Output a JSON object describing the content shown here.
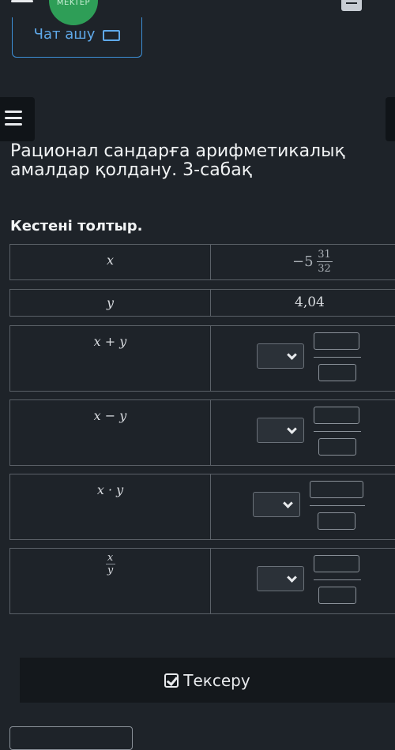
{
  "header": {
    "logo_text": "MEKTEP",
    "chat_button_label": "Чат ашу"
  },
  "lesson": {
    "title": "Рационал сандарға арифметикалық амалдар қолдану. 3-сабақ",
    "instruction": "Кестені толтыр."
  },
  "table": {
    "rows": [
      {
        "label": "x",
        "value_whole": "−5",
        "value_num": "31",
        "value_den": "32"
      },
      {
        "label": "y",
        "value": "4,04"
      },
      {
        "label": "x + y"
      },
      {
        "label": "x − y"
      },
      {
        "label": "x · y"
      },
      {
        "label_num": "x",
        "label_den": "y"
      }
    ]
  },
  "footer": {
    "check_button_label": "Тексеру"
  },
  "icons": {
    "menu": "hamburger-menu-icon",
    "chat": "chat-icon",
    "book": "book-icon",
    "chevron": "chevron-down-icon",
    "check": "check-square-icon"
  }
}
